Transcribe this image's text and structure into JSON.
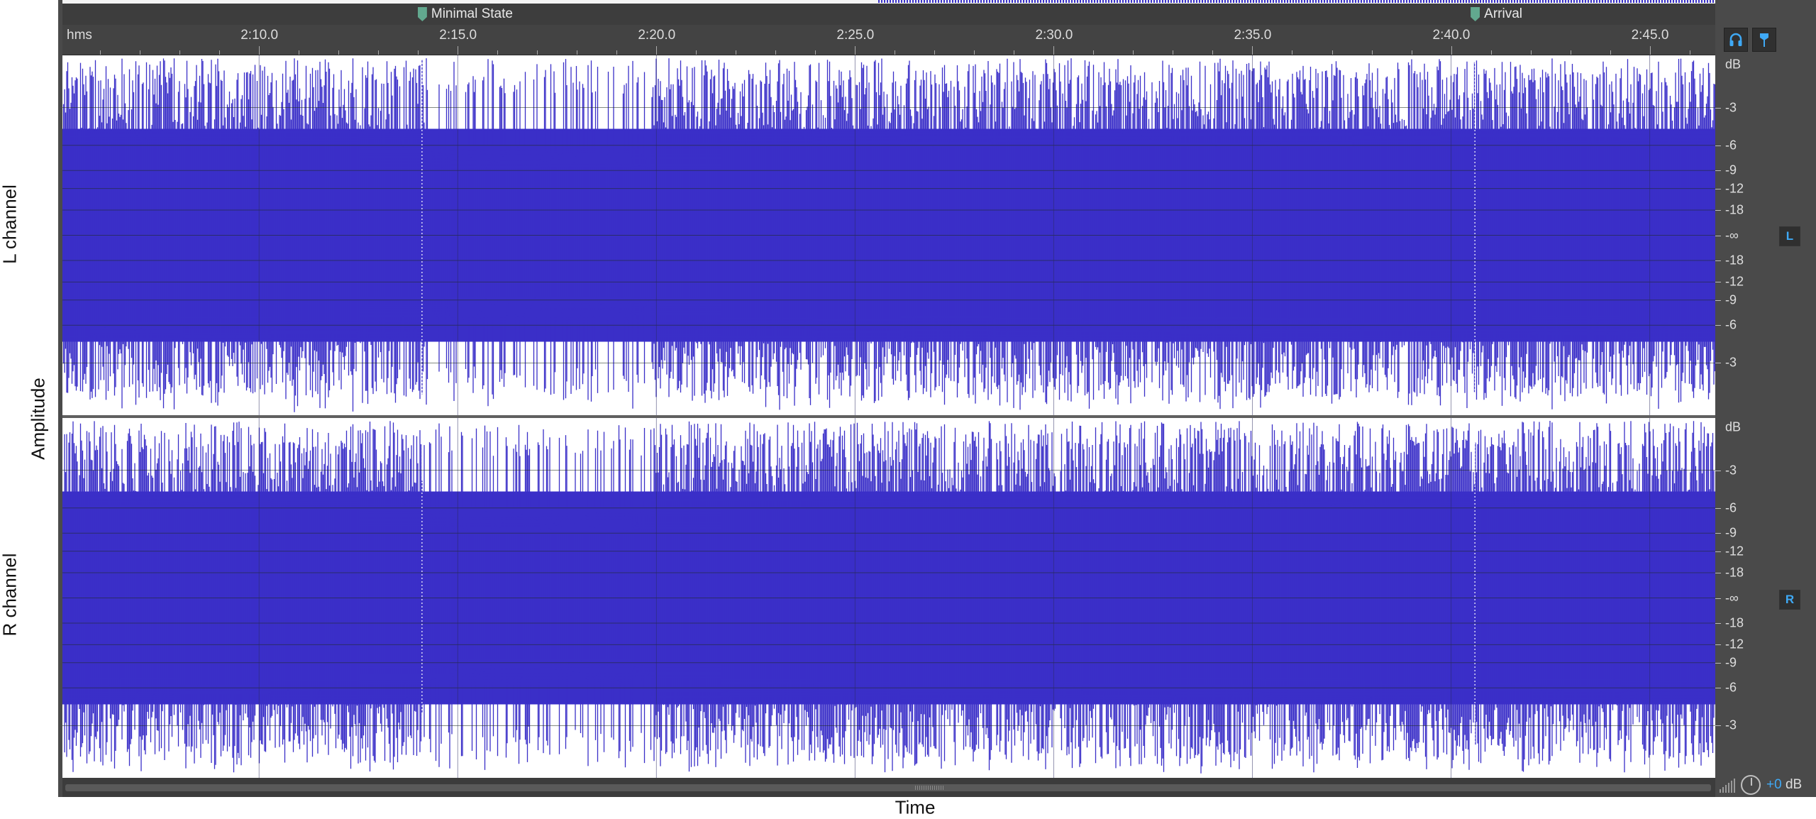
{
  "axes": {
    "left_top": "L channel",
    "left_bottom": "R channel",
    "left_middle": "Amplitude",
    "bottom": "Time"
  },
  "markers": [
    {
      "label": "Minimal State",
      "time": "2:14.1"
    },
    {
      "label": "Arrival",
      "time": "2:40.6"
    }
  ],
  "ruler": {
    "unit": "hms",
    "labels": [
      "2:10.0",
      "2:15.0",
      "2:20.0",
      "2:25.0",
      "2:30.0",
      "2:35.0",
      "2:40.0",
      "2:45.0"
    ],
    "start_seconds": 125.05,
    "end_seconds": 166.65
  },
  "db_scale": {
    "unit": "dB",
    "labels": [
      "-3",
      "-6",
      "-9",
      "-12",
      "-18",
      "-∞",
      "-18",
      "-12",
      "-9",
      "-6",
      "-3"
    ]
  },
  "channels": [
    {
      "badge": "L",
      "name": "L channel"
    },
    {
      "badge": "R",
      "name": "R channel"
    }
  ],
  "toolbar": {
    "headphones": "headphones-icon",
    "marker": "marker-pin-icon"
  },
  "volume": {
    "prefix": "+0",
    "unit": " dB"
  },
  "colors": {
    "waveform": "#3a2fc8",
    "background": "#ffffff",
    "chrome": "#4a4a4a",
    "accent": "#3fa9f5",
    "marker": "#62a88f"
  }
}
